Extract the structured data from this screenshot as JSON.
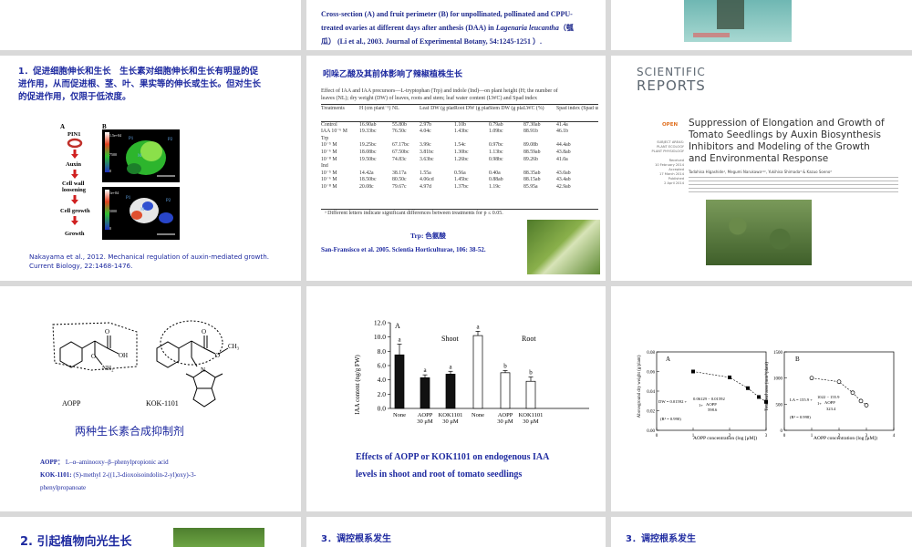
{
  "s1": {
    "caption_line1": "Cross-section (A) and fruit perimeter (B) for unpollinated, pollinated and CPPU-",
    "caption_line2a": "treated ovaries at different days after anthesis (DAA) in ",
    "caption_species": "Lagenaria leucantha",
    "caption_cn": "（瓠",
    "caption_line3a": "瓜）",
    "caption_line3b": "(Li et al., 2003. Journal of Experimental Botany, 54:1245-1251 ）."
  },
  "s2": {
    "heading_line1": "1．促进细胞伸长和生长　生长素对细胞伸长和生长有明显的促",
    "heading_line2": "进作用，从而促进根、茎、叶、果实等的伸长或生长。但对生长",
    "heading_line3": "的促进作用，仅限于低浓度。",
    "panel_a": "A",
    "panel_b": "B",
    "pin1": "PIN1",
    "auxin": "Auxin",
    "cell_wall": "Cell wall",
    "loosening": "loosening",
    "cell_growth": "Cell growth",
    "growth": "Growth",
    "p1": "P1",
    "p2": "P2",
    "m": "M",
    "scale_top": "1.5e+04",
    "scale_top2": "7500",
    "scale_bot": "1e+04",
    "scale_bot2": "5000",
    "scale_zero": "0",
    "citation_line1": "Nakayama  et al., 2012.  Mechanical regulation of auxin-mediated growth.",
    "citation_line2": "Current Biology,  22:1468-1476."
  },
  "s3": {
    "title": "吲哚乙酸及其前体影响了辣椒植株生长",
    "table_caption_line1": "Effect of IAA and IAA precursors—L-tryptophan (Trp) and indole (Ind)—on plant height (H; the number of",
    "table_caption_line2": "leaves (NL); dry weight (DW) of leaves, roots and stem; leaf water content (LWC) and Spad index",
    "headers": [
      "Treatments",
      "H (cm plant⁻¹)",
      "NL",
      "Leaf DW (g plant⁻¹)",
      "Root DW (g plant⁻¹)",
      "Stem DW (g plant⁻¹)",
      "LWC (%)",
      "Spad index (Spad units)"
    ],
    "rows": [
      [
        "Control",
        "16.90ab",
        "55.80b",
        "2.97b",
        "1.10b",
        "0.79ab",
        "87.30ab",
        "41.4a"
      ],
      [
        "IAA 10⁻⁶ M",
        "19.33bc",
        "76.50c",
        "4.04c",
        "1.43bc",
        "1.09bc",
        "88.91b",
        "46.1b"
      ],
      [
        "Trp",
        "",
        "",
        "",
        "",
        "",
        "",
        ""
      ],
      [
        "10⁻⁵ M",
        "19.25bc",
        "67.17bc",
        "3.99c",
        "1.54c",
        "0.97bc",
        "89.08b",
        "44.4ab"
      ],
      [
        "10⁻⁶ M",
        "18.08bc",
        "67.50bc",
        "3.81bc",
        "1.30bc",
        "1.13bc",
        "88.59ab",
        "43.8ab"
      ],
      [
        "10⁻⁸ M",
        "19.50bc",
        "74.83c",
        "3.63bc",
        "1.26bc",
        "0.98bc",
        "89.26b",
        "41.0a"
      ],
      [
        "Ind",
        "",
        "",
        "",
        "",
        "",
        "",
        ""
      ],
      [
        "10⁻⁵ M",
        "14.42a",
        "38.17a",
        "1.55a",
        "0.56a",
        "0.40a",
        "88.35ab",
        "43.0ab"
      ],
      [
        "10⁻⁶ M",
        "18.50bc",
        "80.50c",
        "4.06cd",
        "1.45bc",
        "0.88ab",
        "88.15ab",
        "43.4ab"
      ],
      [
        "10⁻⁸ M",
        "20.08c",
        "79.67c",
        "4.97d",
        "1.37bc",
        "1.19c",
        "85.95a",
        "42.9ab"
      ]
    ],
    "footnote": "ᵃ  Different letters indicate significant differences between treatments for p ≤ 0.05.",
    "trp_label": "Trp:  色氨酸",
    "citation": "San-Fransisco et al. 2005. Scientia Horticulturae, 106: 38-52."
  },
  "s4": {
    "logo_top": "SCIENTIFIC",
    "logo_bottom": "REPORTS",
    "open": "OPEN",
    "title_line1": "Suppression of Elongation and Growth of",
    "title_line2": "Tomato Seedlings by Auxin Biosynthesis",
    "title_line3": "Inhibitors and Modeling of the Growth",
    "title_line4": "and Environmental Response",
    "side_subject": "SUBJECT AREAS:",
    "side_a1": "PLANT ECOLOGY",
    "side_a2": "PLANT PHYSIOLOGY",
    "side_received": "Received",
    "side_received_date": "10 February 2014",
    "side_accepted": "Accepted",
    "side_accepted_date": "17 March 2014",
    "side_published": "Published",
    "side_published_date": "2 April 2014",
    "authors": "Tadahisa Higashide¹, Megumi Narukawa¹²², Yukihisa Shimada³ & Kazuo Soeno³"
  },
  "s5": {
    "label_aopp": "AOPP",
    "label_kok": "KOK-1101",
    "oh": "OH",
    "nh2": "NH₂",
    "o1": "O",
    "o2": "O",
    "o3": "O",
    "o4": "O",
    "ch3": "CH₃",
    "n": "N",
    "title": "两种生长素合成抑制剂",
    "def1_term": "AOPP：",
    "def1_text": "L–α–aminooxy–β–phenylpropionic acid",
    "def2_term": "KOK-1101:",
    "def2_text": "(S)-methyl 2-((1,3-dioxoisoindolin-2-yl)oxy)-3-",
    "def2_text2": "phenylpropanoate"
  },
  "s6": {
    "panel": "A",
    "shoot": "Shoot",
    "root": "Root",
    "ylabel": "IAA content (ng/g FW)",
    "caption_line1": "Effects of AOPP or KOK1101 on endogenous IAA",
    "caption_line2": "levels in shoot and root of tomato seedlings"
  },
  "s7": {
    "panel_a": "A",
    "panel_b": "B",
    "ylabel_a": "Aboveground dry weight (g/plant)",
    "ylabel_b": "Total leaf area (mm²/plant)",
    "xlabel_a": "AOPP concentration (log [μM])",
    "xlabel_b": "AOPP concentration (log [μM])",
    "eq_a1": "DW = 0.01592 +",
    "eq_a2": "0.06129 − 0.01592",
    "eq_a3": "1+",
    "eq_a4": "AOPP",
    "eq_a5": "598.6",
    "r2_a": "(R² = 0.990)",
    "eq_b1": "LA = 155.9 +",
    "eq_b2": "1022 − 155.9",
    "eq_b3": "1+",
    "eq_b4": "AOPP",
    "eq_b5": "323.4",
    "r2_b": "(R² = 0.998)"
  },
  "s8": {
    "title": "2. 引起植物向光生长"
  },
  "s9": {
    "title": "3．调控根系发生"
  },
  "s10": {
    "title": "3．调控根系发生"
  },
  "chart_data": [
    {
      "type": "bar",
      "title": "",
      "ylabel": "IAA content (ng/g FW)",
      "ylim": [
        0,
        12
      ],
      "yticks": [
        "0.0",
        "2.0",
        "4.0",
        "6.0",
        "8.0",
        "10.0",
        "12.0"
      ],
      "groups": [
        "Shoot",
        "Root"
      ],
      "categories": [
        "None",
        "AOPP 30 μM",
        "KOK1101 30 μM",
        "None",
        "AOPP 30 μM",
        "KOK1101 30 μM"
      ],
      "tick_line1": [
        "None",
        "AOPP",
        "KOK1101",
        "None",
        "AOPP",
        "KOK1101"
      ],
      "tick_line2": [
        "",
        "30 μM",
        "30 μM",
        "",
        "30 μM",
        "30 μM"
      ],
      "values": [
        7.5,
        4.3,
        4.8,
        10.2,
        5.0,
        3.8
      ],
      "errors": [
        1.5,
        0.4,
        0.4,
        0.6,
        0.3,
        0.6
      ],
      "letters": [
        "a",
        "a",
        "a",
        "a",
        "b",
        "b"
      ],
      "fill": [
        "#111111",
        "#111111",
        "#111111",
        "#ffffff",
        "#ffffff",
        "#ffffff"
      ]
    },
    {
      "type": "scatter",
      "xlabel": "AOPP concentration (log [μM])",
      "ylabel": "Aboveground dry weight (g/plant)",
      "xlim": [
        0,
        3
      ],
      "ylim": [
        0,
        0.08
      ],
      "xticks": [
        "0",
        "1",
        "2",
        "3"
      ],
      "yticks": [
        "0.00",
        "0.02",
        "0.04",
        "0.06",
        "0.08"
      ],
      "x": [
        1.0,
        2.0,
        2.5,
        2.8,
        3.0
      ],
      "y": [
        0.06,
        0.054,
        0.043,
        0.034,
        0.029
      ]
    },
    {
      "type": "scatter",
      "xlabel": "AOPP concentration (log [μM])",
      "ylabel": "Total leaf area (mm²/plant)",
      "xlim": [
        0,
        4
      ],
      "ylim": [
        0,
        1500
      ],
      "xticks": [
        "0",
        "1",
        "2",
        "3",
        "4"
      ],
      "yticks": [
        "0",
        "500",
        "1000",
        "1500"
      ],
      "x": [
        1.0,
        2.0,
        2.5,
        2.8,
        3.0
      ],
      "y": [
        1000,
        930,
        720,
        560,
        480
      ]
    }
  ]
}
